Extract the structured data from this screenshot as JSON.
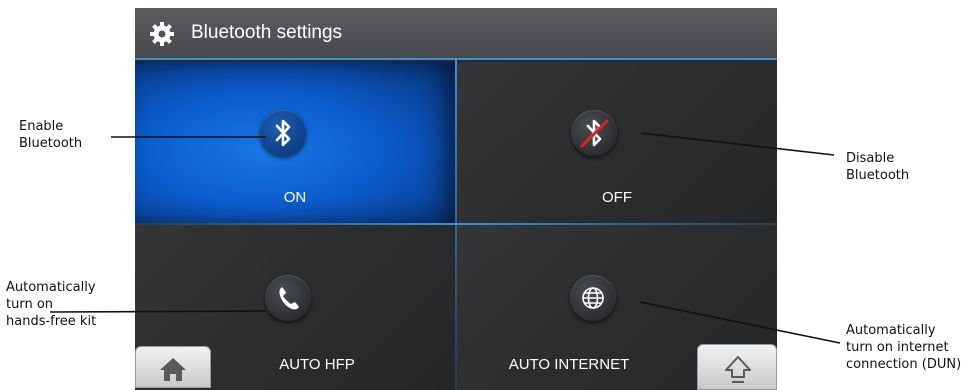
{
  "window": {
    "title": "Bluetooth settings",
    "title_icon": "gear-icon"
  },
  "tiles": [
    {
      "label": "ON",
      "icon": "bluetooth-icon",
      "state": "active"
    },
    {
      "label": "OFF",
      "icon": "bluetooth-off-icon",
      "state": "inactive"
    },
    {
      "label": "AUTO HFP",
      "icon": "phone-icon",
      "state": "inactive"
    },
    {
      "label": "AUTO INTERNET",
      "icon": "globe-icon",
      "state": "inactive"
    }
  ],
  "bottom_buttons": {
    "home_icon": "home-icon",
    "shift_icon": "up-arrow-icon"
  },
  "callouts": {
    "enable": [
      "Enable",
      "Bluetooth"
    ],
    "disable": [
      "Disable",
      "Bluetooth"
    ],
    "hfp": [
      "Automatically",
      "turn on",
      "hands-free kit"
    ],
    "internet": [
      "Automatically",
      "turn on internet",
      "connection (DUN)"
    ]
  },
  "colors": {
    "accent": "#3a8fd8",
    "active_tile": "#0b5bcc",
    "tile_bg": "#2c2e30",
    "titlebar": "#505255",
    "off_strike": "#e02020"
  }
}
